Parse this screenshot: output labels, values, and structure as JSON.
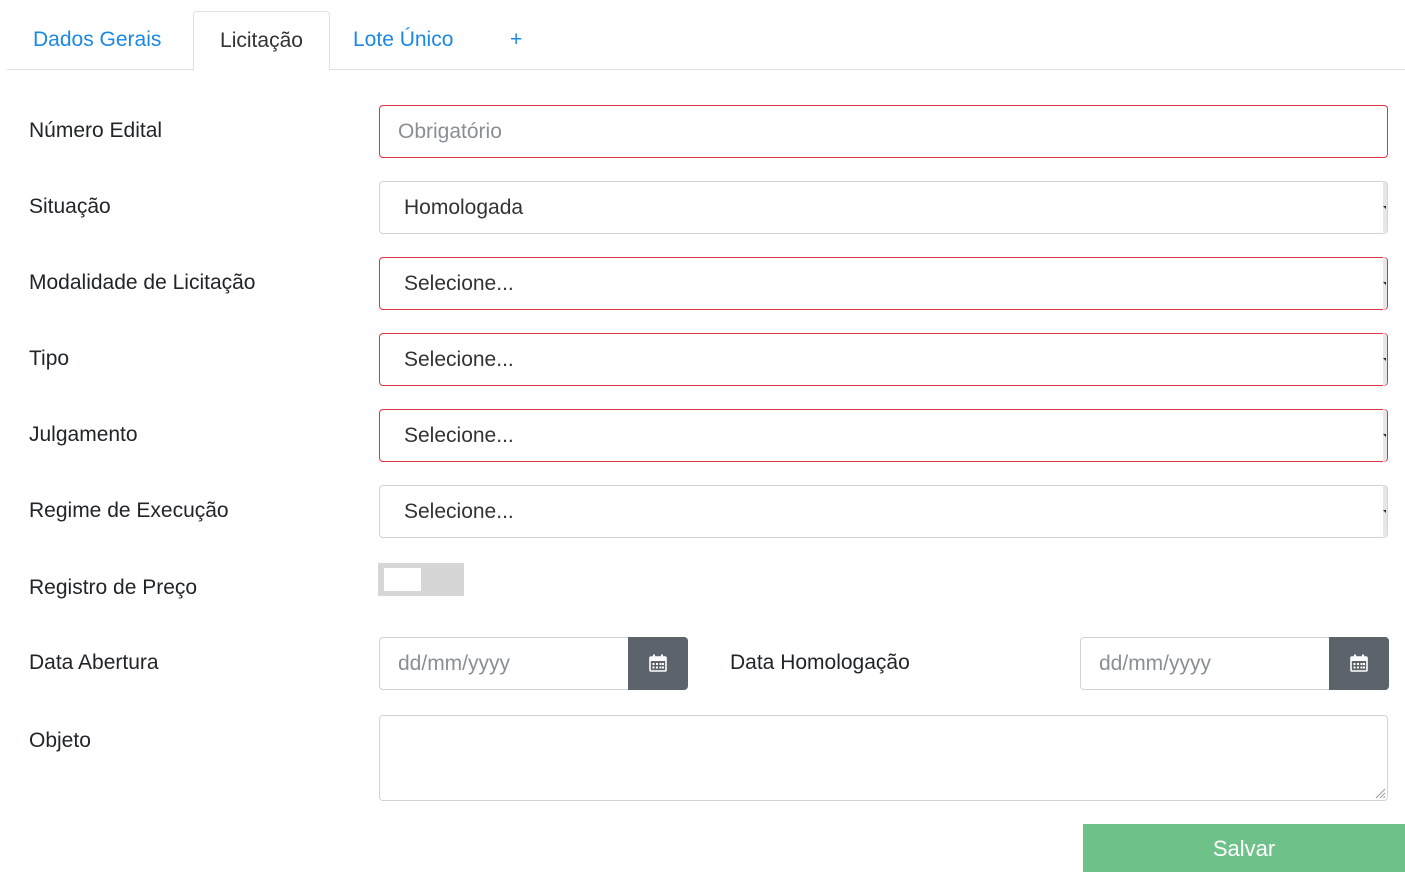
{
  "tabs": [
    {
      "label": "Dados Gerais",
      "active": false
    },
    {
      "label": "Licitação",
      "active": true
    },
    {
      "label": "Lote Único",
      "active": false
    },
    {
      "label": "+",
      "active": false
    }
  ],
  "form": {
    "numero_edital": {
      "label": "Número Edital",
      "value": "",
      "placeholder": "Obrigatório"
    },
    "situacao": {
      "label": "Situação",
      "value": "Homologada"
    },
    "modalidade": {
      "label": "Modalidade de Licitação",
      "value": "Selecione..."
    },
    "tipo": {
      "label": "Tipo",
      "value": "Selecione..."
    },
    "julgamento": {
      "label": "Julgamento",
      "value": "Selecione..."
    },
    "regime": {
      "label": "Regime de Execução",
      "value": "Selecione..."
    },
    "registro_preco": {
      "label": "Registro de Preço",
      "checked": false
    },
    "data_abertura": {
      "label": "Data Abertura",
      "placeholder": "dd/mm/yyyy"
    },
    "data_homologacao": {
      "label": "Data Homologação",
      "placeholder": "dd/mm/yyyy"
    },
    "objeto": {
      "label": "Objeto",
      "value": ""
    }
  },
  "actions": {
    "save_label": "Salvar"
  },
  "colors": {
    "link": "#1a88e6",
    "required_border": "#dc3545",
    "save_button": "#6fc18a",
    "calendar_button": "#5c636a"
  },
  "icons": {
    "date_button": "calendar-icon"
  }
}
